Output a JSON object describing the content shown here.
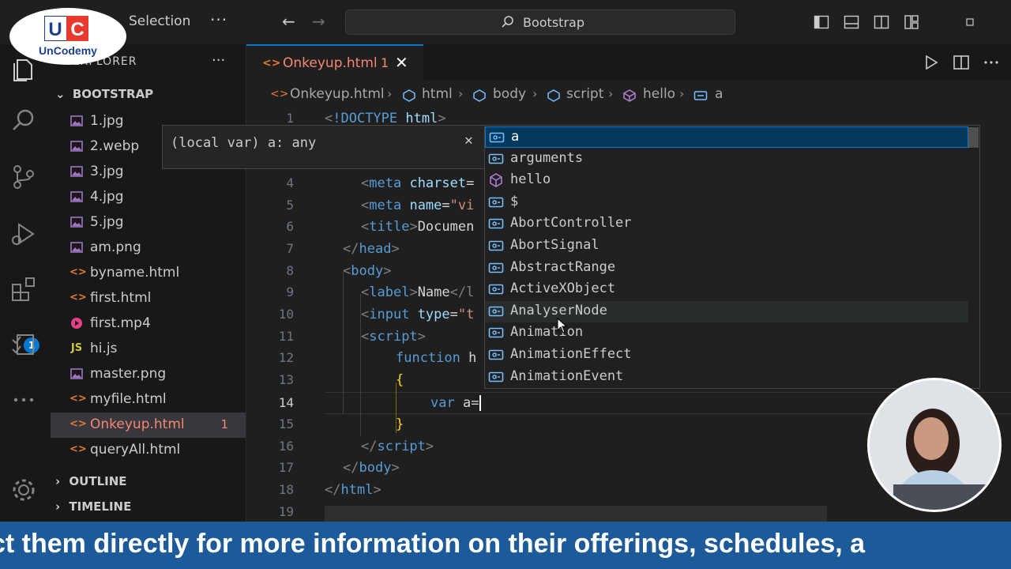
{
  "logo": {
    "letters": "UC",
    "text": "UnCodemy",
    "colors": {
      "blue": "#1d3f8f",
      "red": "#e63a2e"
    }
  },
  "titlebar": {
    "menu_label": "Selection",
    "menu_more": "···",
    "search_label": "Bootstrap"
  },
  "activitybar": {
    "extensions_badge": "1"
  },
  "sidebar": {
    "title": "EXPLORER",
    "more": "···",
    "folder": "BOOTSTRAP",
    "files": [
      {
        "name": "1.jpg",
        "icon": "image-icon"
      },
      {
        "name": "2.webp",
        "icon": "image-icon"
      },
      {
        "name": "3.jpg",
        "icon": "image-icon"
      },
      {
        "name": "4.jpg",
        "icon": "image-icon"
      },
      {
        "name": "5.jpg",
        "icon": "image-icon"
      },
      {
        "name": "am.png",
        "icon": "image-icon"
      },
      {
        "name": "byname.html",
        "icon": "html-icon"
      },
      {
        "name": "first.html",
        "icon": "html-icon"
      },
      {
        "name": "first.mp4",
        "icon": "video-icon"
      },
      {
        "name": "hi.js",
        "icon": "js-icon",
        "glyph": "JS"
      },
      {
        "name": "master.png",
        "icon": "image-icon"
      },
      {
        "name": "myfile.html",
        "icon": "html-icon"
      },
      {
        "name": "Onkeyup.html",
        "icon": "html-icon",
        "badge": "1"
      },
      {
        "name": "queryAll.html",
        "icon": "html-icon"
      }
    ],
    "outline": "OUTLINE",
    "timeline": "TIMELINE"
  },
  "tab": {
    "label": "Onkeyup.html",
    "badge": "1",
    "close": "✕"
  },
  "breadcrumbs": [
    "Onkeyup.html",
    "html",
    "body",
    "script",
    "hello",
    "a"
  ],
  "editor": {
    "line_numbers": [
      "1",
      "4",
      "5",
      "6",
      "7",
      "8",
      "9",
      "10",
      "11",
      "12",
      "13",
      "14",
      "15",
      "16",
      "17",
      "18",
      "19"
    ],
    "active_line": "14",
    "lines": {
      "l1": {
        "lt": "<",
        "bang": "!DOCTYPE",
        "sp": " ",
        "html": "html",
        "gt": ">"
      },
      "l4": {
        "lt": "<",
        "tag": "meta",
        "sp": " ",
        "attr": "charset",
        "eq": "="
      },
      "l5": {
        "lt": "<",
        "tag": "meta",
        "sp": " ",
        "attr": "name",
        "eq": "=",
        "str": "\"vi"
      },
      "l6": {
        "lt": "<",
        "tag": "title",
        "gt": ">",
        "text": "Documen"
      },
      "l7": {
        "lt": "</",
        "tag": "head",
        "gt": ">"
      },
      "l8": {
        "lt": "<",
        "tag": "body",
        "gt": ">"
      },
      "l9": {
        "lt": "<",
        "tag": "label",
        "gt": ">",
        "text": "Name",
        "close": "</l"
      },
      "l10": {
        "lt": "<",
        "tag": "input",
        "sp": " ",
        "attr": "type",
        "eq": "=",
        "str": "\"t"
      },
      "l11": {
        "lt": "<",
        "tag": "script",
        "gt": ">"
      },
      "l12": {
        "kw": "function",
        "sp": " ",
        "name": "h"
      },
      "l13": {
        "brace": "{"
      },
      "l14": {
        "kw": "var",
        "sp": " ",
        "text": "a="
      },
      "l15": {
        "brace": "}"
      },
      "l16": {
        "lt": "</",
        "tag": "script",
        "gt": ">"
      },
      "l17": {
        "lt": "</",
        "tag": "body",
        "gt": ">"
      },
      "l18": {
        "lt": "</",
        "tag": "html",
        "gt": ">"
      }
    }
  },
  "hover": {
    "text": "(local var) a: any",
    "close": "✕"
  },
  "suggestions": [
    {
      "label": "a",
      "kind": "variable-icon"
    },
    {
      "label": "arguments",
      "kind": "variable-icon"
    },
    {
      "label": "hello",
      "kind": "method-icon"
    },
    {
      "label": "$",
      "kind": "variable-icon"
    },
    {
      "label": "AbortController",
      "kind": "variable-icon"
    },
    {
      "label": "AbortSignal",
      "kind": "variable-icon"
    },
    {
      "label": "AbstractRange",
      "kind": "variable-icon"
    },
    {
      "label": "ActiveXObject",
      "kind": "variable-icon"
    },
    {
      "label": "AnalyserNode",
      "kind": "variable-icon"
    },
    {
      "label": "Animation",
      "kind": "variable-icon"
    },
    {
      "label": "AnimationEffect",
      "kind": "variable-icon"
    },
    {
      "label": "AnimationEvent",
      "kind": "variable-icon"
    }
  ],
  "caption": "ct them directly for more information on their offerings, schedules, a",
  "colors": {
    "accent": "#0078d4",
    "error": "#f48771",
    "banner": "#1d5a9a",
    "html_icon": "#e37933",
    "image_icon": "#a074c4",
    "js_icon": "#cbcb41",
    "video_icon": "#e83e8c"
  }
}
